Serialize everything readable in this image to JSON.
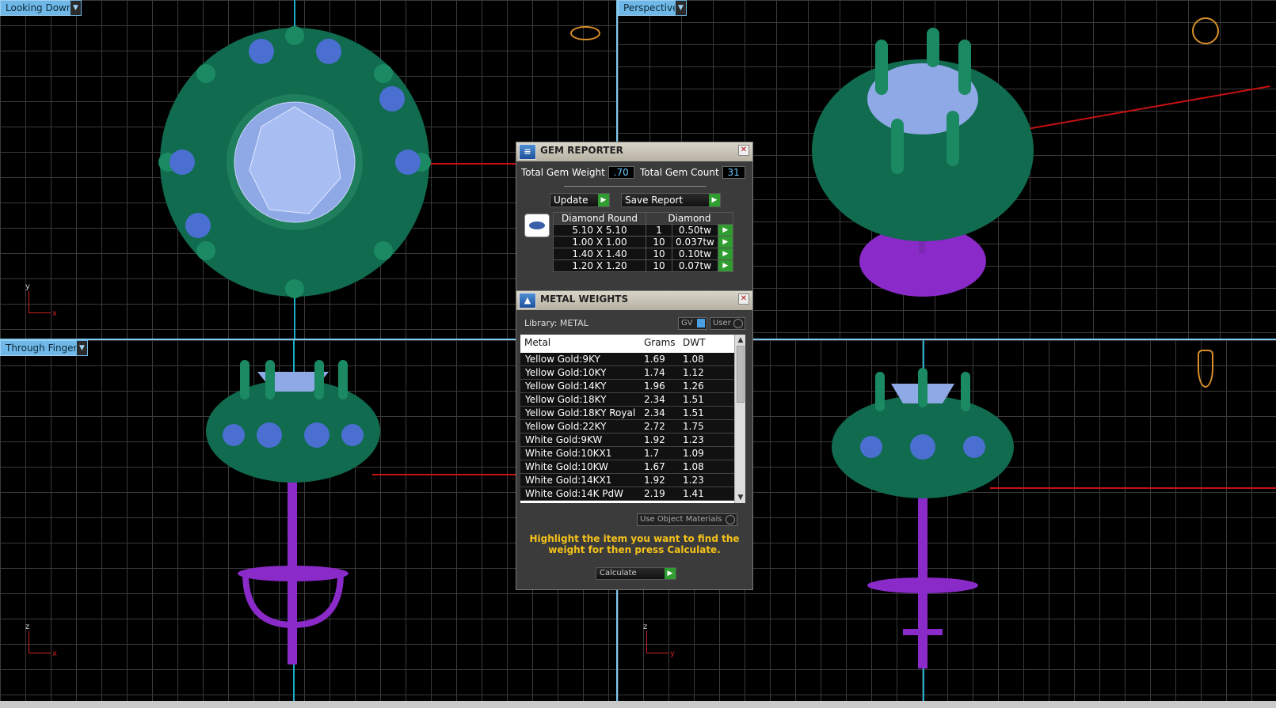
{
  "viewports": {
    "top_left_label": "Looking Down",
    "top_right_label": "Perspective",
    "bottom_left_label": "Through Finger",
    "axes": {
      "y": "y",
      "x": "x",
      "z": "z"
    }
  },
  "gem_reporter": {
    "title": "GEM REPORTER",
    "total_weight_label": "Total Gem Weight",
    "total_weight_value": ".70",
    "total_count_label": "Total Gem Count",
    "total_count_value": "31",
    "update_label": "Update",
    "save_label": "Save Report",
    "table_header": [
      "Diamond Round",
      "Diamond"
    ],
    "rows": [
      {
        "size": "5.10 X 5.10",
        "count": "1",
        "weight": "0.50tw"
      },
      {
        "size": "1.00 X 1.00",
        "count": "10",
        "weight": "0.037tw"
      },
      {
        "size": "1.40 X 1.40",
        "count": "10",
        "weight": "0.10tw"
      },
      {
        "size": "1.20 X 1.20",
        "count": "10",
        "weight": "0.07tw"
      }
    ]
  },
  "metal_weights": {
    "title": "METAL WEIGHTS",
    "library": "Library: METAL",
    "gv": "GV",
    "user": "User",
    "headers": [
      "Metal",
      "Grams",
      "DWT"
    ],
    "rows": [
      {
        "metal": "Yellow Gold:9KY",
        "grams": "1.69",
        "dwt": "1.08"
      },
      {
        "metal": "Yellow Gold:10KY",
        "grams": "1.74",
        "dwt": "1.12"
      },
      {
        "metal": "Yellow Gold:14KY",
        "grams": "1.96",
        "dwt": "1.26"
      },
      {
        "metal": "Yellow Gold:18KY",
        "grams": "2.34",
        "dwt": "1.51"
      },
      {
        "metal": "Yellow Gold:18KY Royal",
        "grams": "2.34",
        "dwt": "1.51"
      },
      {
        "metal": "Yellow Gold:22KY",
        "grams": "2.72",
        "dwt": "1.75"
      },
      {
        "metal": "White Gold:9KW",
        "grams": "1.92",
        "dwt": "1.23"
      },
      {
        "metal": "White Gold:10KX1",
        "grams": "1.7",
        "dwt": "1.09"
      },
      {
        "metal": "White Gold:10KW",
        "grams": "1.67",
        "dwt": "1.08"
      },
      {
        "metal": "White Gold:14KX1",
        "grams": "1.92",
        "dwt": "1.23"
      },
      {
        "metal": "White Gold:14K PdW",
        "grams": "2.19",
        "dwt": "1.41"
      }
    ],
    "use_object_materials": "Use Object Materials",
    "instruction": "Highlight the item you want to find the weight for then press Calculate.",
    "calculate_label": "Calculate"
  }
}
